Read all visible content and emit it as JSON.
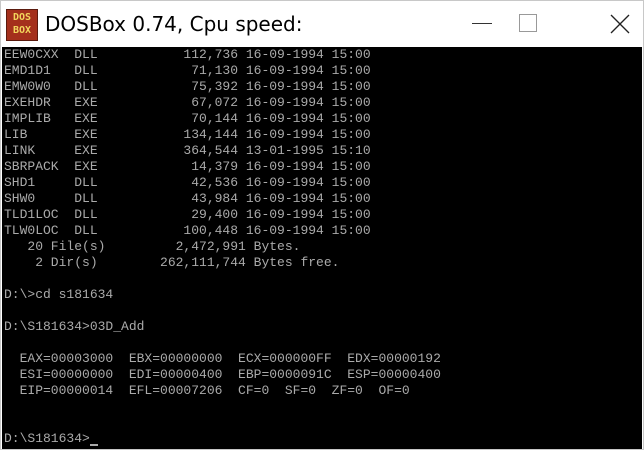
{
  "window": {
    "title": "DOSBox 0.74, Cpu speed:",
    "icon_text_top": "DOS",
    "icon_text_bottom": "BOX",
    "icon_name": "dosbox-icon"
  },
  "console": {
    "lines": [
      "EEW0CXX  DLL           112,736 16-09-1994 15:00",
      "EMD1D1   DLL            71,130 16-09-1994 15:00",
      "EMW0W0   DLL            75,392 16-09-1994 15:00",
      "EXEHDR   EXE            67,072 16-09-1994 15:00",
      "IMPLIB   EXE            70,144 16-09-1994 15:00",
      "LIB      EXE           134,144 16-09-1994 15:00",
      "LINK     EXE           364,544 13-01-1995 15:10",
      "SBRPACK  EXE            14,379 16-09-1994 15:00",
      "SHD1     DLL            42,536 16-09-1994 15:00",
      "SHW0     DLL            43,984 16-09-1994 15:00",
      "TLD1LOC  DLL            29,400 16-09-1994 15:00",
      "TLW0LOC  DLL           100,448 16-09-1994 15:00",
      "   20 File(s)         2,472,991 Bytes.",
      "    2 Dir(s)        262,111,744 Bytes free.",
      "",
      "D:\\>cd s181634",
      "",
      "D:\\S181634>03D_Add",
      "",
      "  EAX=00003000  EBX=00000000  ECX=000000FF  EDX=00000192",
      "  ESI=00000000  EDI=00000400  EBP=0000091C  ESP=00000400",
      "  EIP=00000014  EFL=00007206  CF=0  SF=0  ZF=0  OF=0",
      "",
      "",
      "D:\\S181634>"
    ]
  }
}
